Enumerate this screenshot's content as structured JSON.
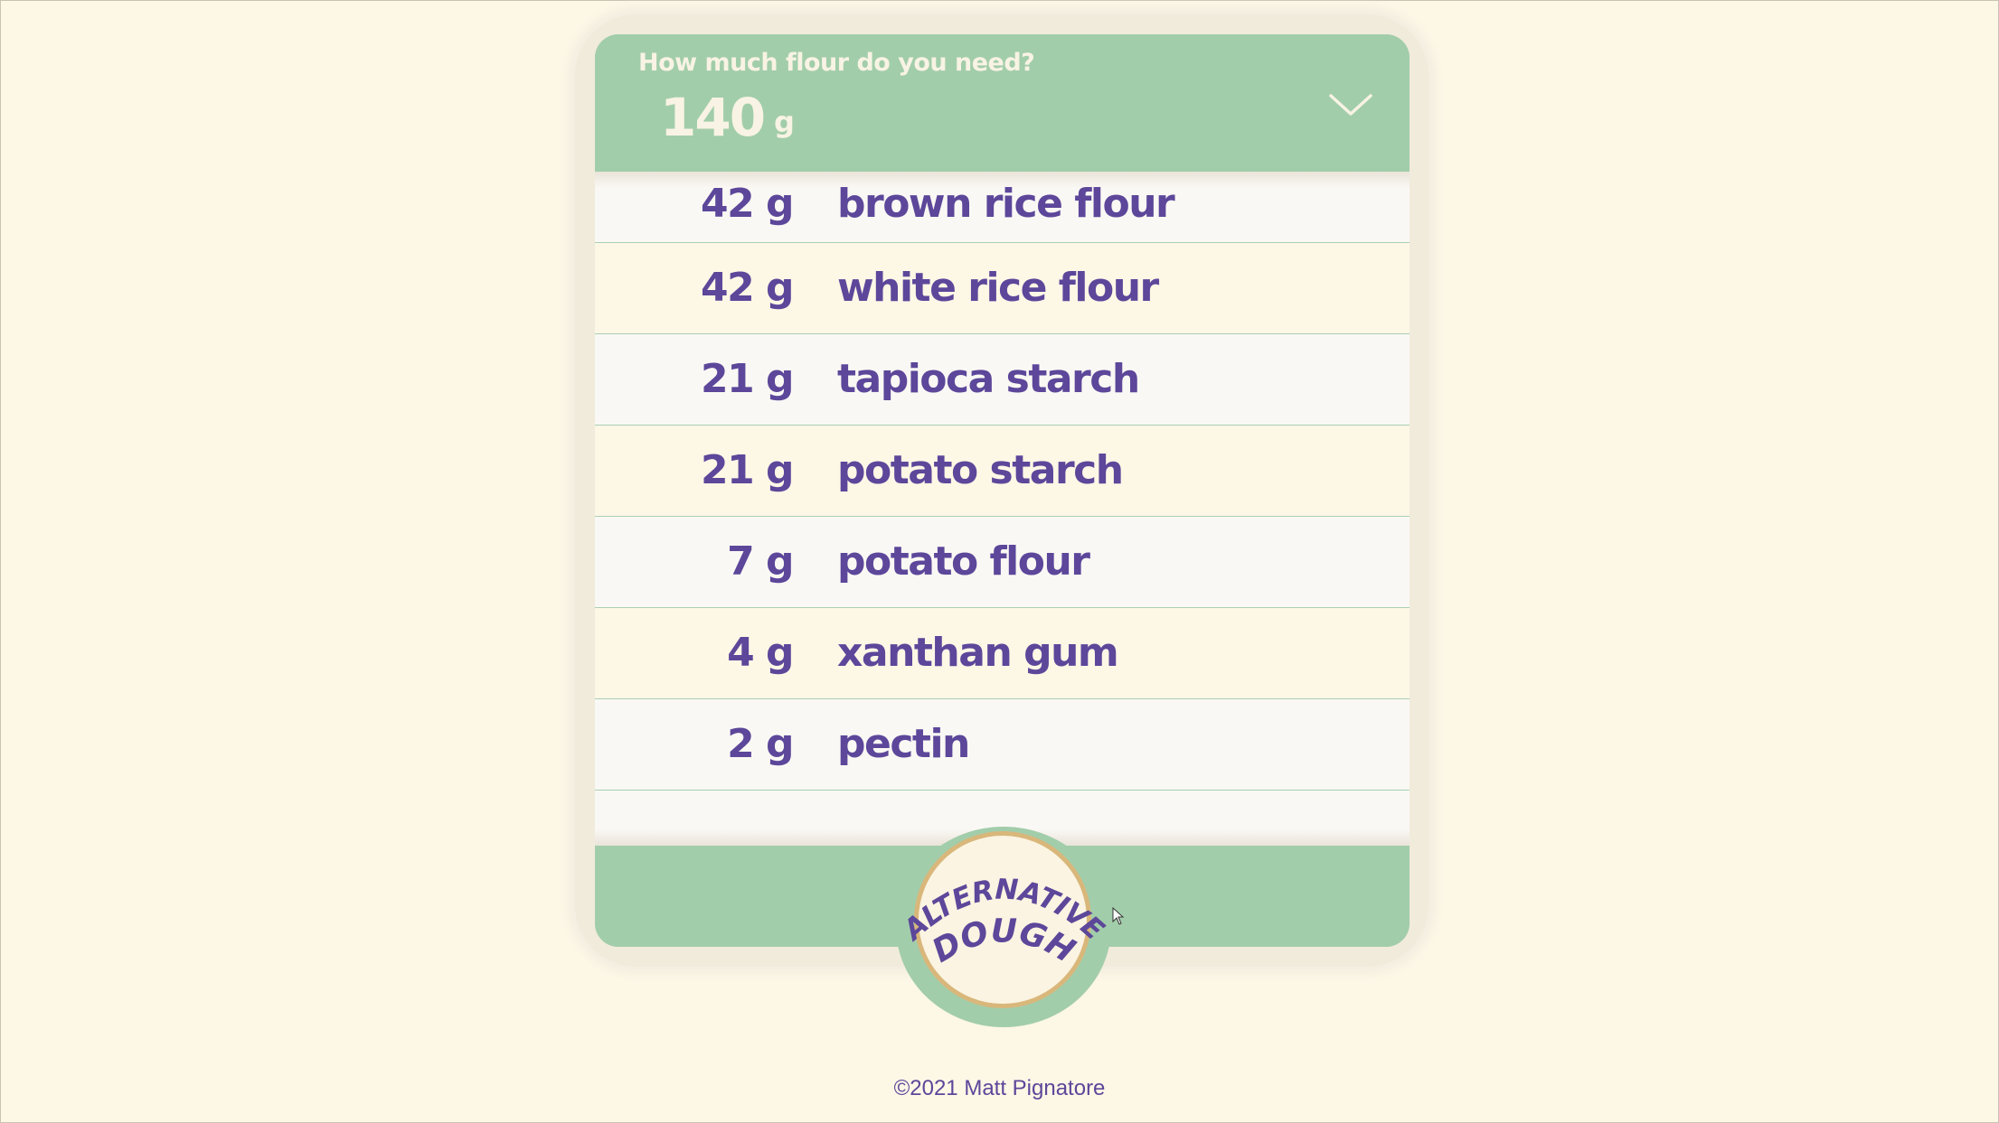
{
  "header": {
    "question": "How much flour do you need?",
    "amount": "140",
    "unit": "g",
    "dropdown_icon": "chevron-down-icon"
  },
  "ingredients": [
    {
      "qty": "42 g",
      "name": "brown rice flour"
    },
    {
      "qty": "42 g",
      "name": "white rice flour"
    },
    {
      "qty": "21 g",
      "name": "tapioca starch"
    },
    {
      "qty": "21 g",
      "name": "potato starch"
    },
    {
      "qty": "7 g",
      "name": "potato flour"
    },
    {
      "qty": "4 g",
      "name": "xanthan gum"
    },
    {
      "qty": "2 g",
      "name": "pectin"
    }
  ],
  "logo": {
    "line1": "ALTERNATIVE",
    "line2": "DOUGH"
  },
  "footer": {
    "copyright": "©2021 Matt Pignatore"
  },
  "colors": {
    "background": "#fdf7e6",
    "green": "#a2cdaa",
    "purple": "#5c479a",
    "cream_text": "#f8f3e4",
    "gold": "#d9b77b"
  }
}
